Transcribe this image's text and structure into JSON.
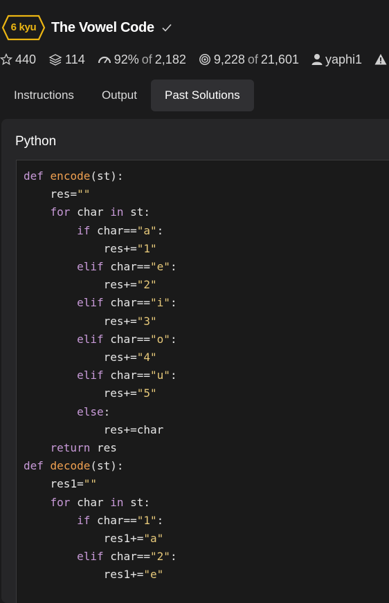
{
  "kata": {
    "rank": "6 kyu",
    "title": "The Vowel Code",
    "accent": "#ecb613"
  },
  "stats": {
    "stars": "440",
    "collections": "114",
    "satisfaction_pct": "92%",
    "of": "of",
    "satisfaction_votes": "2,182",
    "completed": "9,228",
    "attempted": "21,601",
    "author": "yaphi1"
  },
  "tabs": [
    "Instructions",
    "Output",
    "Past Solutions"
  ],
  "active_tab": "Past Solutions",
  "solution": {
    "language": "Python",
    "code_lines": [
      "def encode(st):",
      "    res=\"\"",
      "    for char in st:",
      "        if char==\"a\":",
      "            res+=\"1\"",
      "        elif char==\"e\":",
      "            res+=\"2\"",
      "        elif char==\"i\":",
      "            res+=\"3\"",
      "        elif char==\"o\":",
      "            res+=\"4\"",
      "        elif char==\"u\":",
      "            res+=\"5\"",
      "        else:",
      "            res+=char",
      "    return res",
      "def decode(st):",
      "    res1=\"\"",
      "    for char in st:",
      "        if char==\"1\":",
      "            res1+=\"a\"",
      "        elif char==\"2\":",
      "            res1+=\"e\""
    ]
  }
}
